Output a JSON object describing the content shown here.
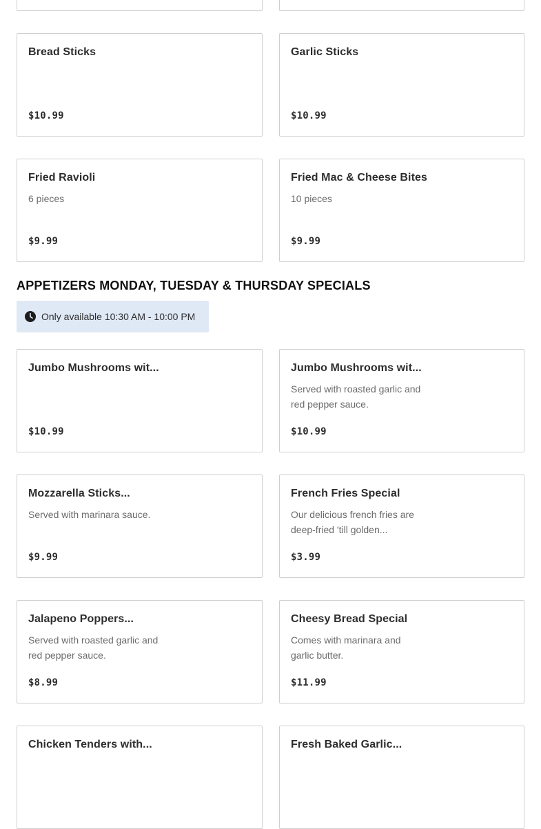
{
  "top_cards": [
    {
      "name": "",
      "price": ""
    },
    {
      "name": "",
      "price": ""
    }
  ],
  "regular_items": [
    {
      "name": "Bread Sticks",
      "description": "",
      "price": "$10.99"
    },
    {
      "name": "Garlic Sticks",
      "description": "",
      "price": "$10.99"
    },
    {
      "name": "Fried Ravioli",
      "description": "6 pieces",
      "price": "$9.99"
    },
    {
      "name": "Fried Mac & Cheese Bites",
      "description": "10 pieces",
      "price": "$9.99"
    }
  ],
  "specials_section": {
    "title": "APPETIZERS MONDAY, TUESDAY & THURSDAY SPECIALS",
    "availability": "Only available 10:30 AM - 10:00 PM",
    "availability_icon": "clock-icon"
  },
  "special_items": [
    {
      "name": "Jumbo Mushrooms wit...",
      "description": "",
      "price": "$10.99"
    },
    {
      "name": "Jumbo Mushrooms wit...",
      "description": "Served with roasted garlic and red pepper sauce.",
      "price": "$10.99"
    },
    {
      "name": "Mozzarella Sticks...",
      "description": "Served with marinara sauce.",
      "price": "$9.99"
    },
    {
      "name": "French Fries Special",
      "description": "Our delicious french fries are deep-fried 'till golden...",
      "price": "$3.99"
    },
    {
      "name": "Jalapeno Poppers...",
      "description": "Served with roasted garlic and red pepper sauce.",
      "price": "$8.99"
    },
    {
      "name": "Cheesy Bread Special",
      "description": "Comes with marinara and garlic butter.",
      "price": "$11.99"
    },
    {
      "name": "Chicken Tenders with...",
      "description": "",
      "price": ""
    },
    {
      "name": "Fresh Baked Garlic...",
      "description": "",
      "price": ""
    }
  ],
  "colors": {
    "border": "#cfcfcf",
    "availability_bg": "#dfe9f6",
    "text": "#2d2d2d",
    "muted": "#6b6b6b"
  }
}
